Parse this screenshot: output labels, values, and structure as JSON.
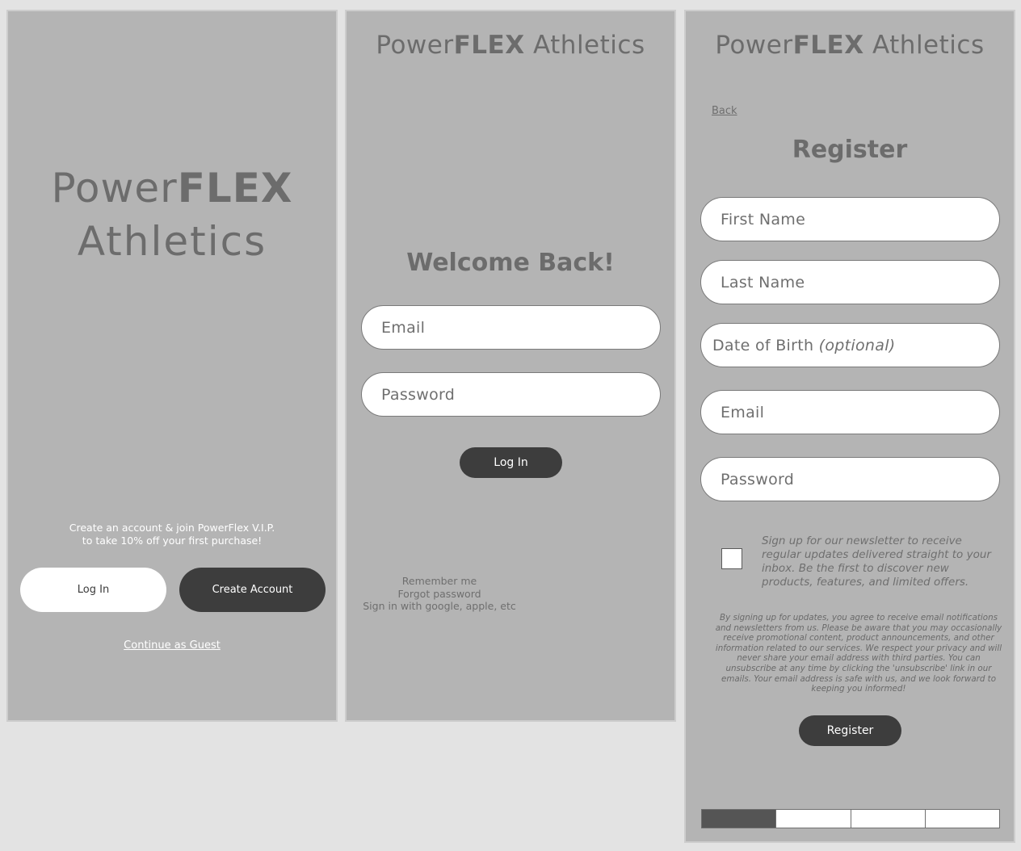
{
  "brand": {
    "power": "Power",
    "flex": "FLEX",
    "athletics": "Athletics"
  },
  "welcome_screen": {
    "promo_line1": "Create an account & join PowerFlex V.I.P.",
    "promo_line2": "to take 10% off your first purchase!",
    "login_button": "Log In",
    "create_account_button": "Create Account",
    "guest_link": "Continue as Guest"
  },
  "login_screen": {
    "heading": "Welcome Back!",
    "email_placeholder": "Email",
    "password_placeholder": "Password",
    "login_button": "Log In",
    "remember_me": "Remember me",
    "forgot_password": "Forgot password",
    "social_signin": "Sign in with google, apple, etc"
  },
  "register_screen": {
    "back_link": "Back",
    "heading": "Register",
    "first_name_placeholder": "First Name",
    "last_name_placeholder": "Last Name",
    "dob_placeholder": "Date of Birth",
    "dob_optional": "(optional)",
    "email_placeholder": "Email",
    "password_placeholder": "Password",
    "newsletter_text": "Sign up for our newsletter to receive regular updates delivered straight to your inbox. Be the first to discover new products, features, and limited offers.",
    "legal_text": "By signing up for updates, you agree to receive email notifications and newsletters from us. Please be aware that you may occasionally receive promotional content, product announcements, and other information related to our services. We respect your privacy and will never share your email address with third parties. You can unsubscribe at any time by clicking the 'unsubscribe' link in our emails. Your email address is safe with us, and we look forward to keeping you informed!",
    "register_button": "Register",
    "progress_step": 1,
    "progress_total": 4
  },
  "colors": {
    "panel_bg": "#b4b4b4",
    "page_bg": "#e3e3e3",
    "dark_button": "#3d3d3d",
    "text_gray": "#6c6c6c"
  }
}
